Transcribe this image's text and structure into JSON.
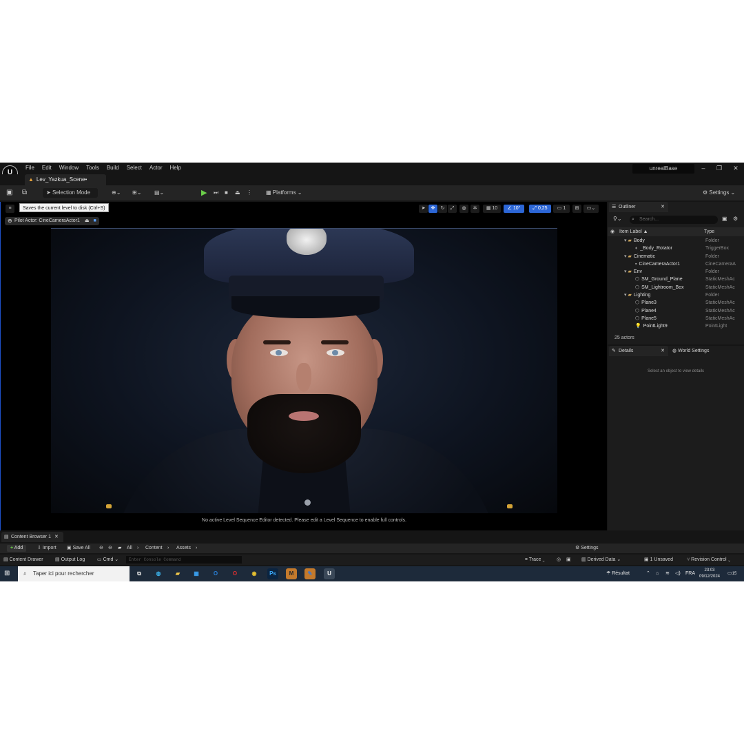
{
  "window": {
    "project_name": "unrealBase",
    "minimize": "–",
    "restore": "❐",
    "close": "✕"
  },
  "menu": [
    "File",
    "Edit",
    "Window",
    "Tools",
    "Build",
    "Select",
    "Actor",
    "Help"
  ],
  "level_tab": {
    "label": "Lev_Yazkua_Scene•"
  },
  "toolbar": {
    "selection_mode": "Selection Mode",
    "platforms": "Platforms",
    "settings": "Settings"
  },
  "tooltip": "Saves the current level to disk (Ctrl+S)",
  "viewport": {
    "grid_snap": "10",
    "rotation_snap": "10°",
    "scale_snap": "0,25",
    "camera_speed": "1",
    "pilot_label": "Pilot Actor: CineCameraActor1",
    "sequence_message": "No active Level Sequence Editor detected. Please edit a Level Sequence to enable full controls."
  },
  "outliner": {
    "tab": "Outliner",
    "search_placeholder": "Search...",
    "col_label": "Item Label ▲",
    "col_type": "Type",
    "rows": [
      {
        "label": "Body",
        "type": "Folder"
      },
      {
        "label": "_Body_Rotator",
        "type": "TriggerBox"
      },
      {
        "label": "Cinematic",
        "type": "Folder"
      },
      {
        "label": "CineCameraActor1",
        "type": "CineCameraA"
      },
      {
        "label": "Env",
        "type": "Folder"
      },
      {
        "label": "SM_Ground_Plane",
        "type": "StaticMeshAc"
      },
      {
        "label": "SM_Lightroom_Box",
        "type": "StaticMeshAc"
      },
      {
        "label": "Lighting",
        "type": "Folder"
      },
      {
        "label": "Plane3",
        "type": "StaticMeshAc"
      },
      {
        "label": "Plane4",
        "type": "StaticMeshAc"
      },
      {
        "label": "Plane5",
        "type": "StaticMeshAc"
      },
      {
        "label": "PointLight9",
        "type": "PointLight"
      }
    ],
    "actor_count": "25 actors"
  },
  "details": {
    "tab": "Details",
    "world_settings_tab": "World Settings",
    "empty_message": "Select an object to view details"
  },
  "content_browser": {
    "tab": "Content Browser 1",
    "add": "Add",
    "import": "Import",
    "save_all": "Save All",
    "breadcrumb": [
      "All",
      "Content",
      "Assets"
    ],
    "settings": "Settings"
  },
  "status_bar": {
    "content_drawer": "Content Drawer",
    "output_log": "Output Log",
    "cmd": "Cmd",
    "console_placeholder": "Enter Console Command",
    "trace": "Trace",
    "derived_data": "Derived Data",
    "unsaved": "1 Unsaved",
    "revision_control": "Revision Control"
  },
  "taskbar": {
    "search_placeholder": "Taper ici pour rechercher",
    "weather": "Résultat",
    "language": "FRA",
    "time": "23:03",
    "date": "09/12/2024",
    "notification_count": "15"
  }
}
